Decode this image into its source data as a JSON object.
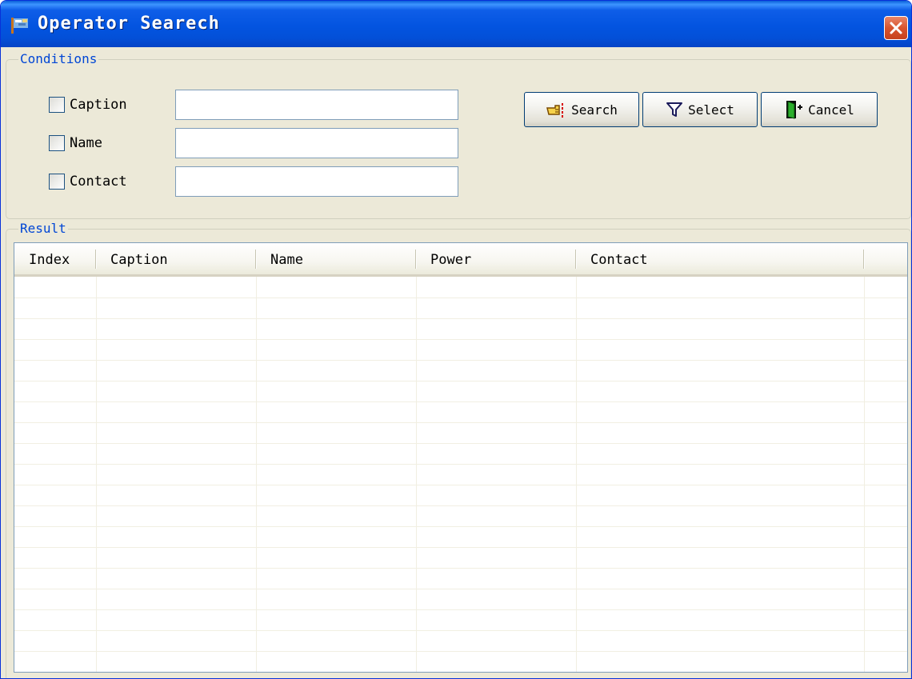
{
  "window": {
    "title": "Operator Searech",
    "colors": {
      "titlebar": "#0354e0",
      "close_button": "#d8542e",
      "face": "#ece9d8",
      "groupbox_legend": "#0046d5"
    }
  },
  "conditions": {
    "legend": "Conditions",
    "fields": [
      {
        "label": "Caption",
        "checked": false,
        "value": ""
      },
      {
        "label": "Name",
        "checked": false,
        "value": ""
      },
      {
        "label": "Contact",
        "checked": false,
        "value": ""
      }
    ],
    "buttons": [
      {
        "label": "Search",
        "icon": "hand-pointer-icon"
      },
      {
        "label": "Select",
        "icon": "filter-funnel-icon"
      },
      {
        "label": "Cancel",
        "icon": "exit-door-icon"
      }
    ]
  },
  "result": {
    "legend": "Result",
    "columns": [
      "Index",
      "Caption",
      "Name",
      "Power",
      "Contact"
    ],
    "rows": []
  }
}
